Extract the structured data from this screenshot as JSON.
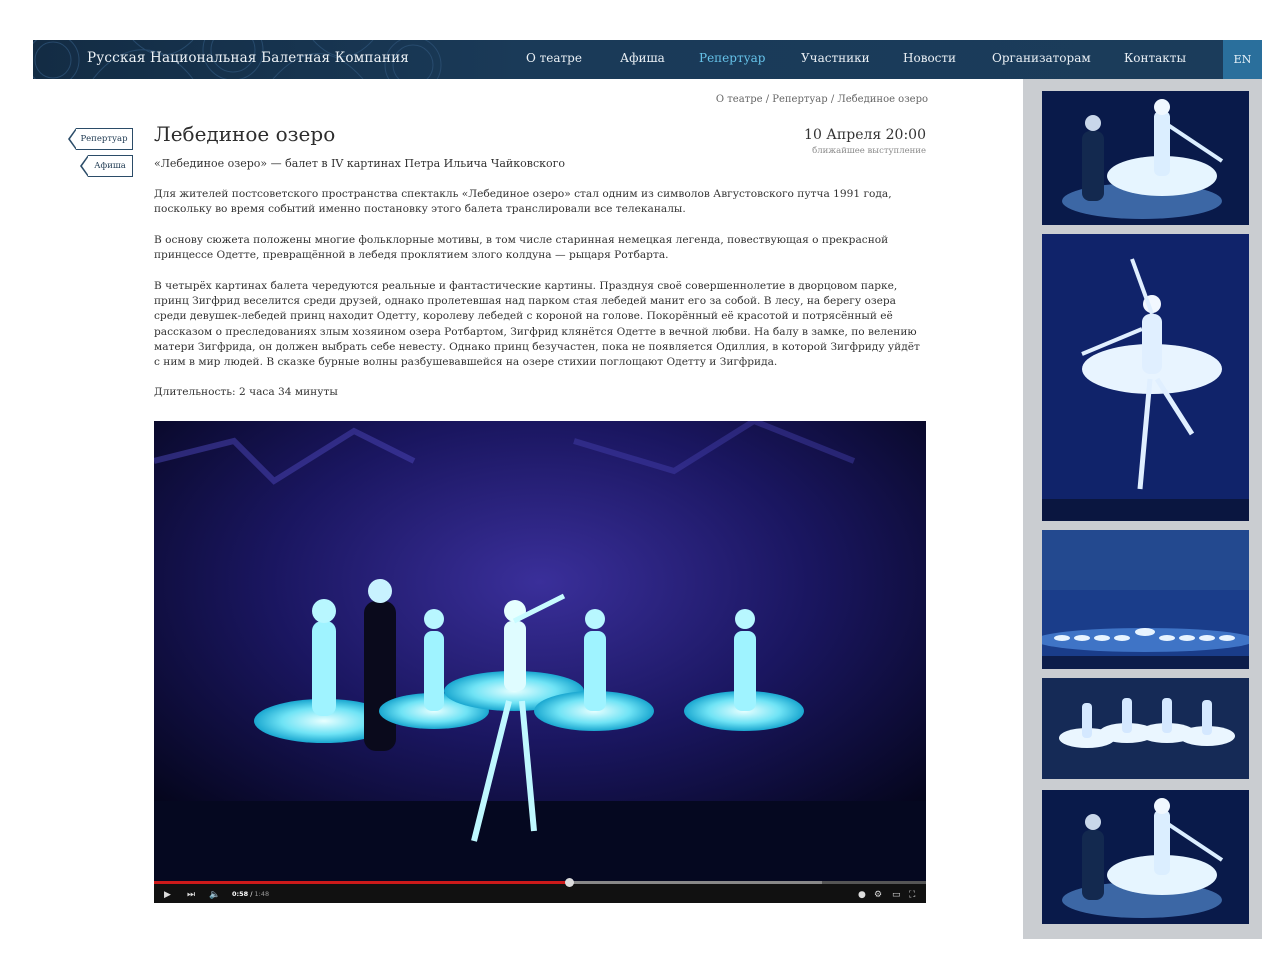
{
  "header": {
    "brand": "Русская Национальная Балетная Компания",
    "nav": [
      {
        "label": "О театре",
        "active": false
      },
      {
        "label": "Афиша",
        "active": false
      },
      {
        "label": "Репертуар",
        "active": true
      },
      {
        "label": "Участники",
        "active": false
      },
      {
        "label": "Новости",
        "active": false
      },
      {
        "label": "Организаторам",
        "active": false
      },
      {
        "label": "Контакты",
        "active": false
      }
    ],
    "lang": "EN"
  },
  "breadcrumb": "О театре / Репертуар / Лебединое озеро",
  "side_tags": [
    "Репертуар",
    "Афиша"
  ],
  "performance": {
    "title": "Лебединое озеро",
    "date": "10 Апреля 20:00",
    "date_note": "ближайшее выступление",
    "subtitle": "«Лебединое озеро» — балет в IV картинах Петра Ильича Чайковского",
    "paragraphs": [
      "Для жителей постсоветского пространства спектакль «Лебединое озеро» стал одним из символов Августовского путча 1991 года, поскольку во время событий именно постановку этого балета транслировали все телеканалы.",
      "В основу сюжета положены многие фольклорные мотивы, в том числе старинная немецкая легенда, повествующая о прекрасной принцессе Одетте, превращённой в лебедя проклятием злого колдуна — рыцаря Ротбарта.",
      "В четырёх картинах балета чередуются реальные и фантастические картины. Празднуя своё совершеннолетие в дворцовом парке, принц Зигфрид веселится среди друзей, однако пролетевшая над парком стая лебедей манит его за собой. В лесу, на берегу озера среди девушек-лебедей принц находит Одетту, королеву лебедей с короной на голове. Покорённый её красотой и потрясённый её рассказом о преследованиях злым хозяином озера Ротбартом, Зигфрид клянётся Одетте в вечной любви. На балу в замке, по велению матери Зигфрида, он должен выбрать себе невесту. Однако принц безучастен, пока не появляется Одиллия, в которой Зигфриду  уйдёт с ним в мир людей. В сказке бурные волны разбушевавшейся на озере стихии поглощают Одетту и Зигфрида.",
      "Длительность: 2 часа 34 минуты"
    ]
  },
  "video": {
    "current_time": "0:58",
    "duration": "1:48",
    "progress_fraction": 0.537
  },
  "gallery": [
    "photo-1",
    "photo-2",
    "photo-3",
    "photo-4",
    "photo-5"
  ],
  "colors": {
    "header_bg": "#1a3a58",
    "nav_active": "#66c3ea",
    "lang_bg": "#2a6f9c",
    "progress": "#cc1a1a",
    "sidebar_bg": "#cacdd1"
  }
}
